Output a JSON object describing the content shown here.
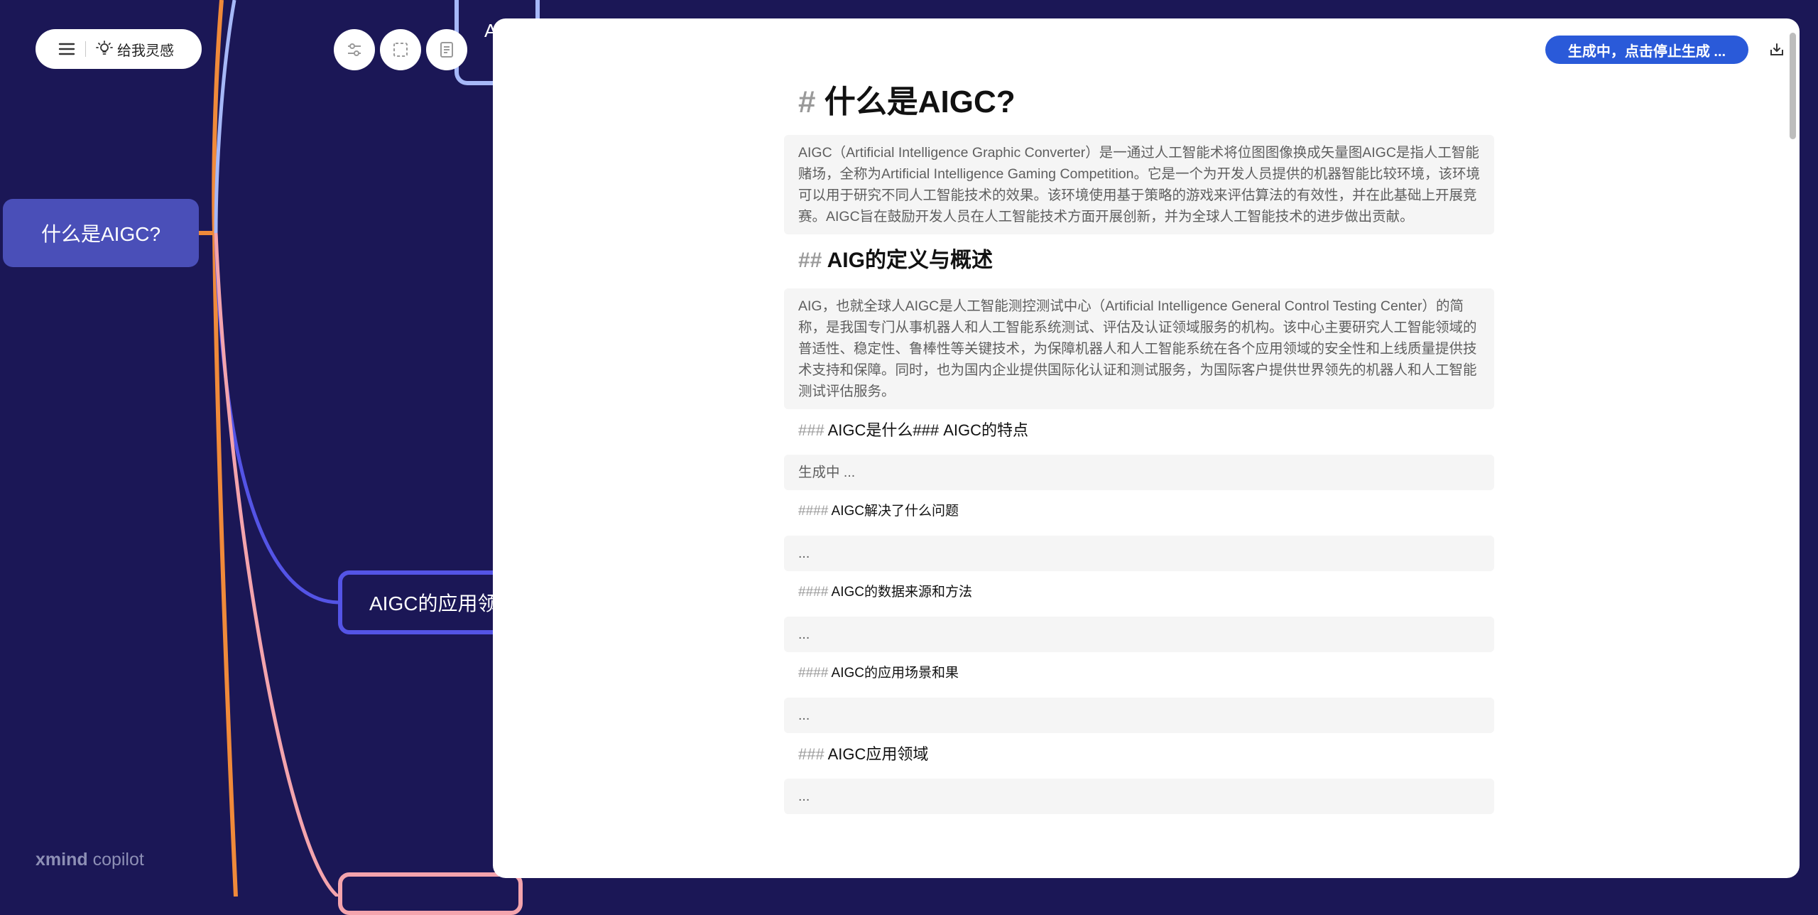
{
  "toolbar": {
    "inspire_label": "给我灵感"
  },
  "brand": {
    "part1": "xmind",
    "part2": " copilot"
  },
  "mindmap": {
    "root": "什么是AIGC?",
    "child": "AIGC的应用领域",
    "top_node": "A"
  },
  "panel": {
    "generate_button": "生成中，点击停止生成 ...",
    "doc": {
      "h1_hash": "#",
      "h1": "什么是AIGC?",
      "p1": "AIGC（Artificial Intelligence Graphic Converter）是一通过人工智能术将位图图像换成矢量图AIGC是指人工智能赌场，全称为Artificial Intelligence Gaming Competition。它是一个为开发人员提供的机器智能比较环境，该环境可以用于研究不同人工智能技术的效果。该环境使用基于策略的游戏来评估算法的有效性，并在此基础上开展竞赛。AIGC旨在鼓励开发人员在人工智能技术方面开展创新，并为全球人工智能技术的进步做出贡献。",
      "h2_hash": "##",
      "h2": "AIG的定义与概述",
      "p2": "AIG，也就全球人AIGC是人工智能测控测试中心（Artificial Intelligence General Control Testing Center）的简称，是我国专门从事机器人和人工智能系统测试、评估及认证领域服务的机构。该中心主要研究人工智能领域的普适性、稳定性、鲁棒性等关键技术，为保障机器人和人工智能系统在各个应用领域的安全性和上线质量提供技术支持和保障。同时，也为国内企业提供国际化认证和测试服务，为国际客户提供世界领先的机器人和人工智能测试评估服务。",
      "h3a_hash": "###",
      "h3a": "AIGC是什么### AIGC的特点",
      "p3": "生成中 ...",
      "h4a_hash": "####",
      "h4a": "AIGC解决了什么问题",
      "p4": "...",
      "h4b_hash": "####",
      "h4b": "AIGC的数据来源和方法",
      "p5": "...",
      "h4c_hash": "####",
      "h4c": "AIGC的应用场景和果",
      "p6": "...",
      "h3b_hash": "###",
      "h3b": "AIGC应用领域",
      "p7": "..."
    }
  },
  "icons": {
    "menu": "menu-icon",
    "bulb": "lightbulb-icon",
    "settings": "sliders-icon",
    "select": "selection-icon",
    "document": "document-icon",
    "export": "export-icon"
  },
  "colors": {
    "canvas_bg": "#1b1756",
    "root_node": "#4a4fb8",
    "branch_orange": "#f08a3a",
    "branch_blue": "#5454e6",
    "branch_light_blue": "#a6b8f8",
    "branch_pink": "#f4a4ad",
    "generate_button": "#2a5ad9"
  }
}
